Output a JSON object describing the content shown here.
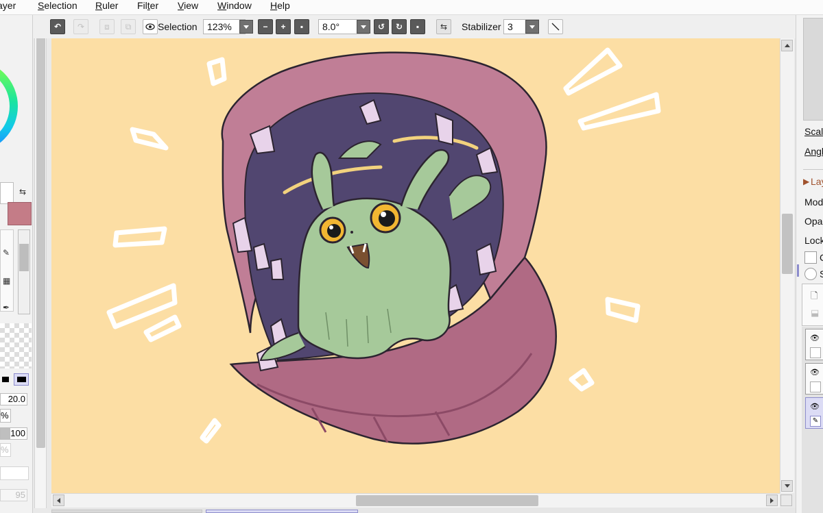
{
  "menu": [
    {
      "label": "ayer",
      "key": ""
    },
    {
      "label": "Selection",
      "key": "S"
    },
    {
      "label": "Ruler",
      "key": "R"
    },
    {
      "label": "Filter",
      "key": "t"
    },
    {
      "label": "View",
      "key": "V"
    },
    {
      "label": "Window",
      "key": "W"
    },
    {
      "label": "Help",
      "key": "H"
    }
  ],
  "toolbar": {
    "selection_label": "Selection",
    "zoom_value": "123%",
    "angle_value": "8.0°",
    "stabilizer_label": "Stabilizer",
    "stabilizer_value": "3"
  },
  "leftpanel": {
    "size_value": "20.0",
    "percent_a": "%",
    "density_value": "100",
    "percent_b": "%",
    "last_value": "95"
  },
  "rightpanel": {
    "scale_label": "Scale",
    "angle_label": "Angl",
    "layer_header": "Lay",
    "mode_label": "Mode",
    "opacity_label": "Opac",
    "lock_label": "Lock",
    "check_label": "C",
    "radio_label": "S"
  },
  "colors": {
    "canvas_bg": "#fcdea4",
    "primary_color": "#c47c87",
    "accent": "#8c8ccc"
  }
}
